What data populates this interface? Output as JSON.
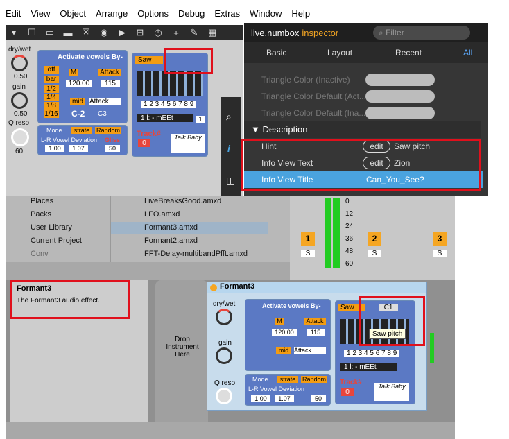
{
  "menu": [
    "Edit",
    "View",
    "Object",
    "Arrange",
    "Options",
    "Debug",
    "Extras",
    "Window",
    "Help"
  ],
  "inspector": {
    "title_object": "live.numbox",
    "title_suffix": "inspector",
    "filter_placeholder": "Filter",
    "tabs": [
      "Basic",
      "Layout",
      "Recent",
      "All"
    ],
    "faded": [
      "Triangle Color (Inactive)",
      "Triangle Color Default (Act...",
      "Triangle Color Default (Ina..."
    ],
    "section": "Description",
    "rows": [
      {
        "label": "Hint",
        "edit": "edit",
        "value": "Saw pitch"
      },
      {
        "label": "Info View Text",
        "edit": "edit",
        "value": "Zion"
      },
      {
        "label": "Info View Title",
        "value": "Can_You_See?"
      }
    ]
  },
  "device": {
    "name": "Formant3",
    "drywet_label": "dry/wet",
    "drywet_val": "0.50",
    "gain_label": "gain",
    "gain_val": "0.50",
    "qreso_label": "Q reso",
    "qreso_val": "60",
    "activate": "Activate vowels By-",
    "off": "off",
    "bar": "bar",
    "f12": "1/2",
    "f14": "1/4",
    "f18": "1/8",
    "f116": "1/16",
    "m": "M",
    "tempo": "120.00",
    "attack": "Attack",
    "attack_val": "115",
    "mid": "mid",
    "attack2": "Attack",
    "note": "C-2",
    "note2": "C3",
    "mode": "Mode",
    "strate": "strate",
    "random": "Random",
    "lr": "L-R Vowel Deviation",
    "lr_val": "1.00",
    "lr_val2": "1.07",
    "gliss": "Gliss",
    "gliss_val": "50",
    "saw": "Saw",
    "c1": "C1",
    "seq": "1 2 3 4 5 6 7 8 9",
    "preset": "1 l: - mEEt",
    "preset_n": "1",
    "track": "Track#",
    "track_val": "0",
    "logo": "Talk Baby",
    "tooltip": "Saw pitch"
  },
  "browser": {
    "places": [
      "Places",
      "Packs",
      "User Library",
      "Current Project",
      "Conv"
    ],
    "files": [
      "LiveBreaksGood.amxd",
      "LFO.amxd",
      "Formant3.amxd",
      "Formant2.amxd",
      "FFT-Delay-multibandPfft.amxd"
    ]
  },
  "info": {
    "title": "Formant3",
    "text": "The Formant3 audio effect."
  },
  "drop": {
    "text": "Drop Instrument Here"
  },
  "mixer": {
    "scale": [
      "0",
      "12",
      "24",
      "36",
      "48",
      "60"
    ],
    "tracks": [
      "1",
      "2",
      "3"
    ],
    "s": "S"
  }
}
